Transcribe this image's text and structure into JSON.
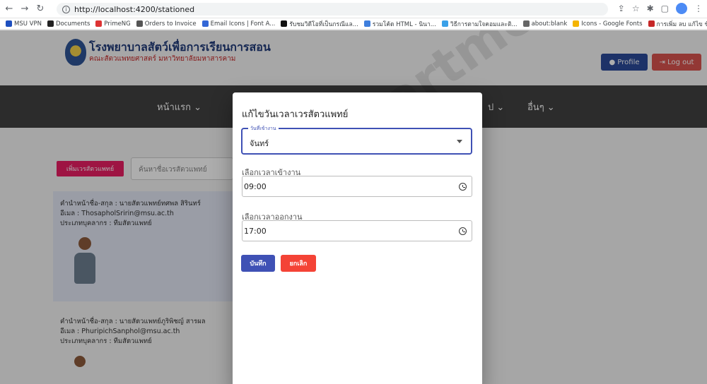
{
  "browser": {
    "url": "http://localhost:4200/stationed",
    "bookmarks": [
      {
        "label": "MSU VPN",
        "color": "#1e4fbf"
      },
      {
        "label": "Documents",
        "color": "#222222"
      },
      {
        "label": "PrimeNG",
        "color": "#dd3333"
      },
      {
        "label": "Orders to Invoice",
        "color": "#555555"
      },
      {
        "label": "Email Icons | Font A...",
        "color": "#3367d6"
      },
      {
        "label": "รับชมวิดีโอที่เป็นกรณีแล...",
        "color": "#111111"
      },
      {
        "label": "รวมโค้ด HTML - นินา...",
        "color": "#3f7fdd"
      },
      {
        "label": "วิธีการตามใจคอมและติ...",
        "color": "#3aa0e8"
      },
      {
        "label": "about:blank",
        "color": "#666666"
      },
      {
        "label": "Icons - Google Fonts",
        "color": "#f4b400"
      },
      {
        "label": "การเพิ่ม ลบ แก้ไข ข้อมู...",
        "color": "#c62828"
      }
    ]
  },
  "header": {
    "title": "โรงพยาบาลสัตว์เพื่อการเรียนการสอน",
    "subtitle": "คณะสัตวแพทยศาสตร์ มหาวิทยาลัยมหาสารคาม",
    "profile_label": "Profile",
    "logout_label": "Log out"
  },
  "nav": {
    "home": "หน้าแรก ⌄",
    "general": "ป ⌄",
    "other": "อื่นๆ ⌄"
  },
  "toolbar": {
    "add_label": "เพิ่มเวรสัตวแพทย์",
    "search_placeholder": "ค้นหาชื่อเวรสัตวแพทย์"
  },
  "cards": [
    {
      "name": "คำนำหน้าชื่อ-สกุล : นายสัตวแพทย์ทศพล สิรินทร์",
      "email": "อีเมล : ThosapholSririn@msu.ac.th",
      "type": "ประเภทบุคลากร : ทีมสัตวแพทย์"
    },
    {
      "name": "คำนำหน้าชื่อ-สกุล : นายสัตวแพทย์ภูริพิชญ์ สารผล",
      "email": "อีเมล : PhuripichSanphol@msu.ac.th",
      "type": "ประเภทบุคลากร : ทีมสัตวแพทย์"
    }
  ],
  "watermark": "Department ... Mahasarakham University",
  "dialog": {
    "title": "แก้ไขวันเวลาเวรสัตวแพทย์",
    "day_label": "วันที่เข้างาน",
    "day_value": "จันทร์",
    "start_label": "เลือกเวลาเข้างาน",
    "start_value": "09:00",
    "end_label": "เลือกเวลาออกงาน",
    "end_value": "17:00",
    "save_label": "บันทึก",
    "cancel_label": "ยกเลิก"
  }
}
